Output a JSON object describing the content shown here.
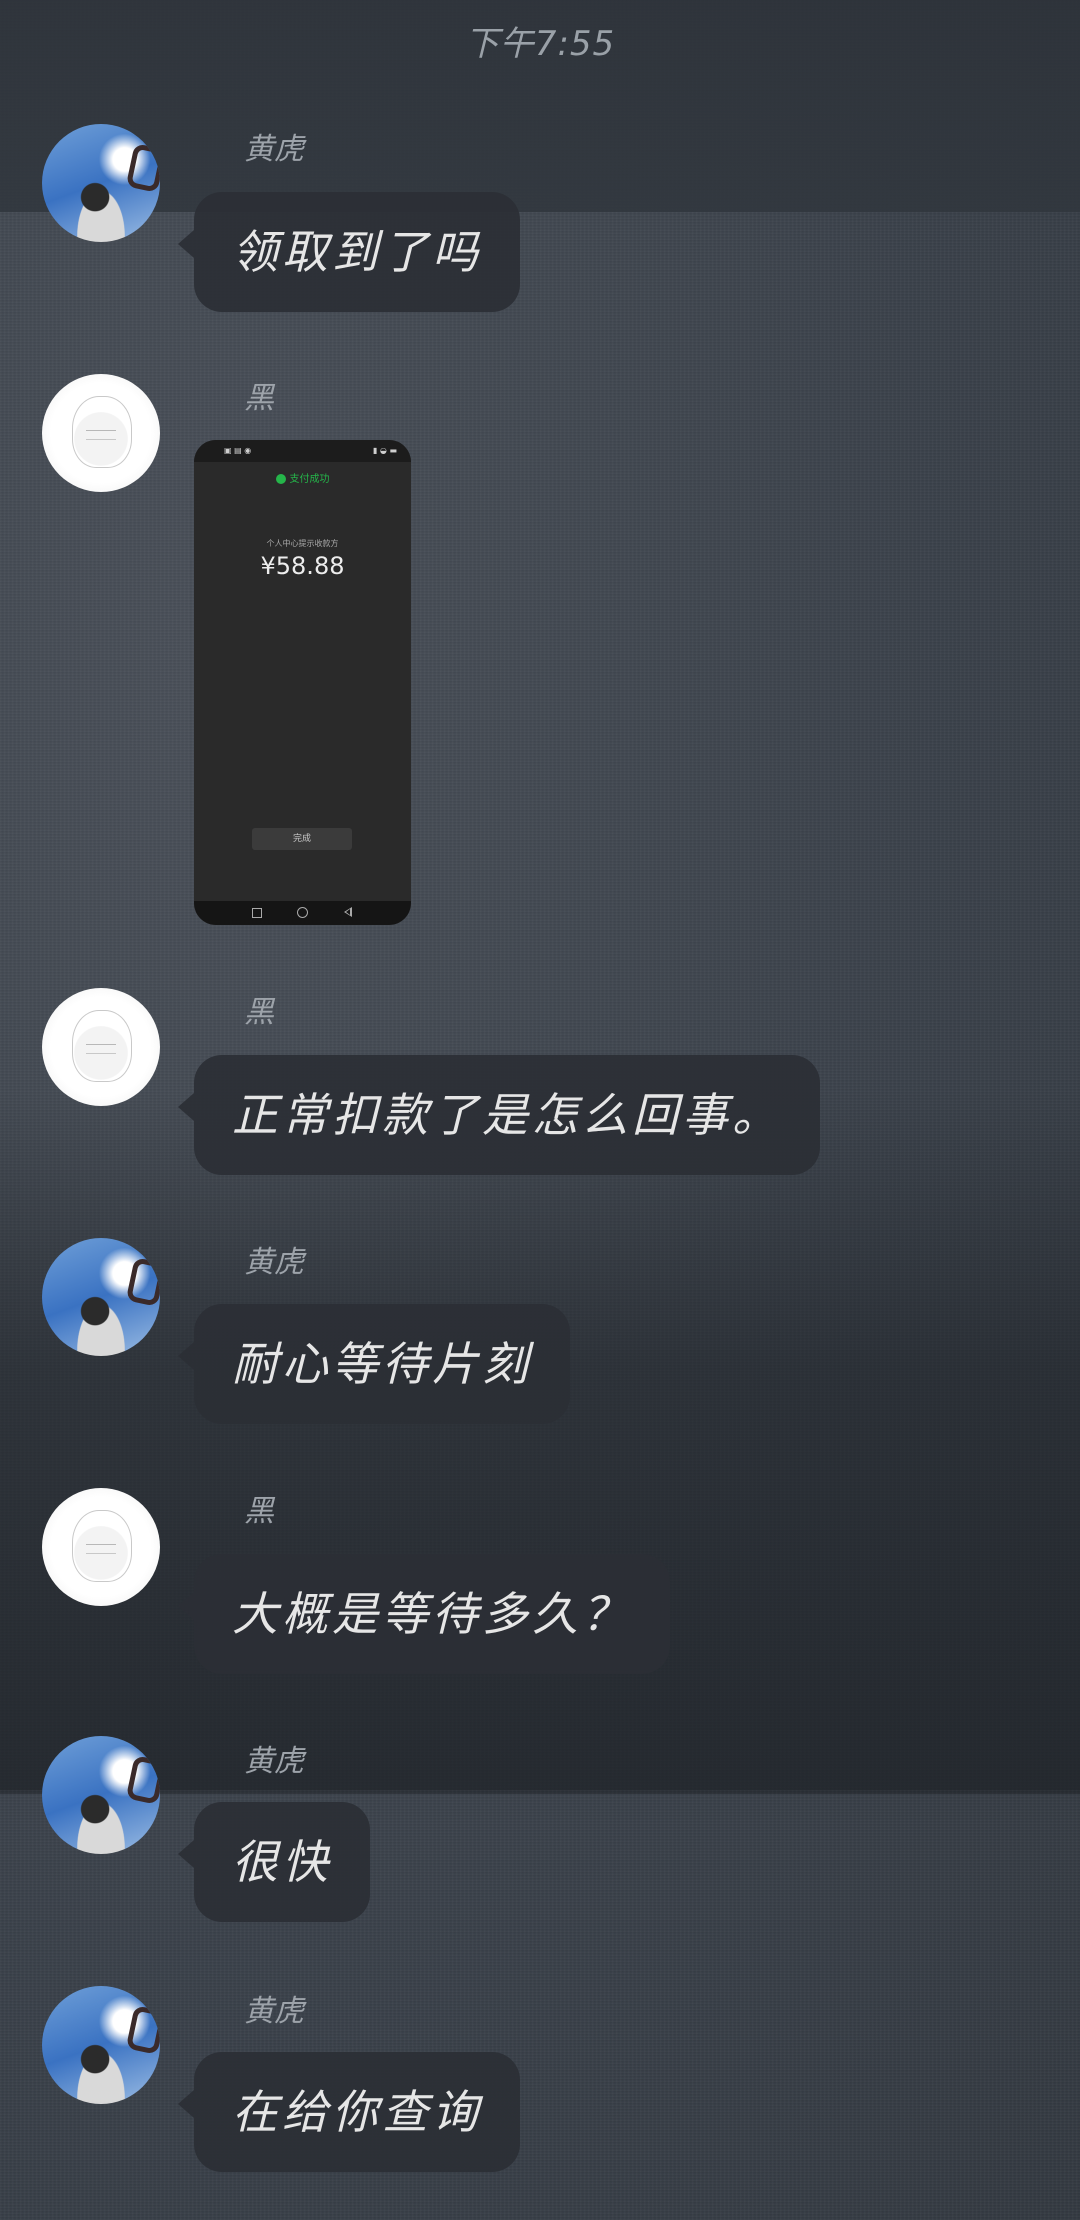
{
  "status_bar": {
    "time": "下午7:55"
  },
  "messages": [
    {
      "sender": "黄虎",
      "avatar": "sky-avatar",
      "text": "领取到了吗"
    },
    {
      "sender": "黑",
      "avatar": "sketch-avatar",
      "image": {
        "title": "支付成功",
        "description": "个人中心提示收款方",
        "amount": "¥58.88",
        "button": "完成"
      }
    },
    {
      "sender": "黑",
      "avatar": "sketch-avatar",
      "text": "正常扣款了是怎么回事。"
    },
    {
      "sender": "黄虎",
      "avatar": "sky-avatar",
      "text": "耐心等待片刻"
    },
    {
      "sender": "黑",
      "avatar": "sketch-avatar",
      "text": "大概是等待多久？"
    },
    {
      "sender": "黄虎",
      "avatar": "sky-avatar",
      "text": "很快"
    },
    {
      "sender": "黄虎",
      "avatar": "sky-avatar",
      "text": "在给你查询"
    }
  ],
  "colors": {
    "bubble": "#2b2f35",
    "accent_green": "#25b54a",
    "background": "#3d454e"
  }
}
